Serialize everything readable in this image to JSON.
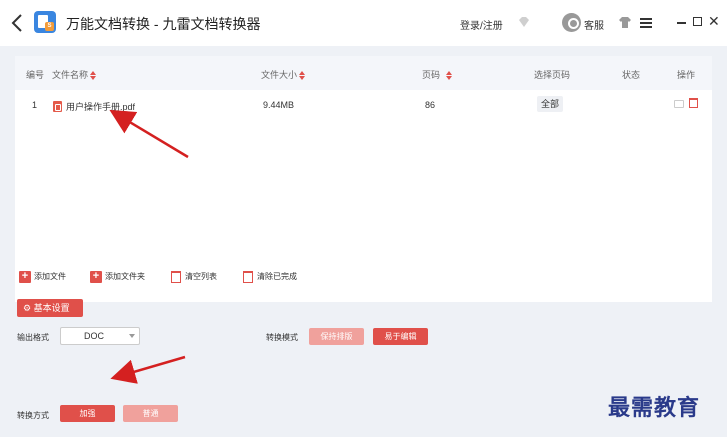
{
  "app": {
    "title": "万能文档转换 - 九雷文档转换器",
    "login": "登录/注册",
    "service": "客服"
  },
  "table": {
    "headers": {
      "index": "编号",
      "name": "文件名称",
      "size": "文件大小",
      "pages": "页码",
      "select_pages": "选择页码",
      "status": "状态",
      "ops": "操作"
    },
    "rows": [
      {
        "index": "1",
        "name": "用户操作手册.pdf",
        "size": "9.44MB",
        "pages": "86",
        "select": "全部",
        "status": ""
      }
    ]
  },
  "actions": {
    "add_file": "添加文件",
    "add_folder": "添加文件夹",
    "clear_list": "清空列表",
    "clear_done": "清除已完成"
  },
  "settings": {
    "basic_label": "基本设置",
    "output_format_label": "输出格式",
    "output_format_value": "DOC",
    "convert_mode_label": "转换模式",
    "mode_keep_layout": "保持排版",
    "mode_easy_edit": "易于编辑",
    "convert_method_label": "转换方式",
    "method_fast": "加强",
    "method_normal": "普通"
  },
  "watermark": "最需教育",
  "colors": {
    "accent": "#e0504a",
    "accent_light": "#f0a19c",
    "arrow": "#d42020"
  }
}
